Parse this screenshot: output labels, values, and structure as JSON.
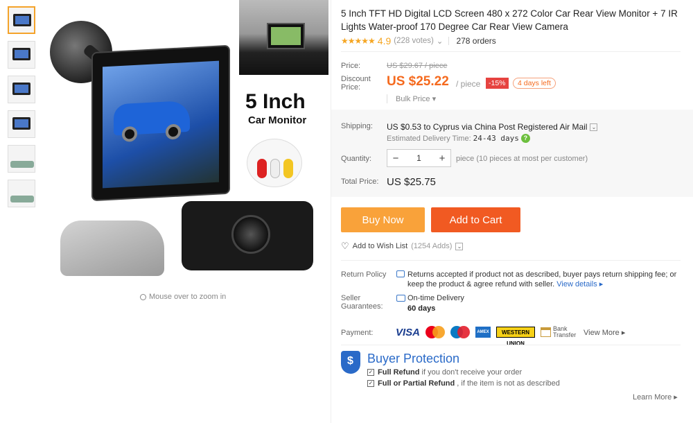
{
  "gallery": {
    "thumb_count": 6,
    "zoom_hint": "Mouse over to zoom in",
    "image_text_primary": "5 Inch",
    "image_text_secondary": "Car Monitor"
  },
  "product": {
    "title": "5 Inch TFT HD Digital LCD Screen 480 x 272 Color Car Rear View Monitor + 7 IR Lights Water-proof 170 Degree Car Rear View Camera",
    "rating": "4.9",
    "votes": "(228 votes)",
    "orders": "278 orders"
  },
  "price": {
    "label": "Price:",
    "original": "US $29.67 / piece",
    "discount_label": "Discount Price:",
    "current": "US $25.22",
    "per_unit": "/ piece",
    "discount_badge": "-15%",
    "days_left": "4 days left",
    "bulk": "Bulk Price ▾"
  },
  "shipping": {
    "label": "Shipping:",
    "value": "US $0.53 to Cyprus via China Post Registered Air Mail",
    "delivery_label": "Estimated Delivery Time:",
    "delivery_days": "24-43 days"
  },
  "quantity": {
    "label": "Quantity:",
    "value": "1",
    "minus": "−",
    "plus": "+",
    "note": "piece (10 pieces at most per customer)"
  },
  "total": {
    "label": "Total Price:",
    "value": "US $25.75"
  },
  "actions": {
    "buy_now": "Buy Now",
    "add_to_cart": "Add to Cart",
    "wishlist": "Add to Wish List",
    "wishlist_count": "(1254 Adds)"
  },
  "return_policy": {
    "label": "Return Policy",
    "text": "Returns accepted if product not as described, buyer pays return shipping fee; or keep the product & agree refund with seller.",
    "link": "View details ▸"
  },
  "guarantee": {
    "label": "Seller Guarantees:",
    "line1": "On-time Delivery",
    "line2": "60 days"
  },
  "payment": {
    "label": "Payment:",
    "visa": "VISA",
    "amex": "AMEX",
    "western_union": "WESTERN UNION",
    "bank": "Bank Transfer",
    "view_more": "View More ▸"
  },
  "buyer_protection": {
    "title": "Buyer Protection",
    "item1_bold": "Full Refund",
    "item1_rest": " if you don't receive your order",
    "item2_bold": "Full or Partial Refund",
    "item2_rest": " , if the item is not as described",
    "learn_more": "Learn More ▸"
  },
  "colors": {
    "accent_orange": "#f56a1e",
    "buy_now": "#f9a23a",
    "add_to_cart": "#f15a22",
    "link_blue": "#2a6ac8"
  }
}
